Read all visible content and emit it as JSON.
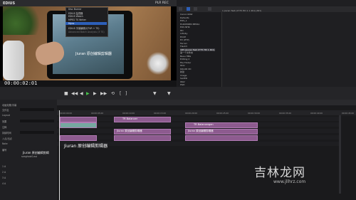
{
  "titlebar": {
    "app_name": "EDIUS",
    "plr_label": "PLR REC"
  },
  "preview": {
    "timecode": "00:00:02:01",
    "screen_caption": "Jiuran 原创编辑剪辑器",
    "menu": [
      {
        "label": "Disc Burner",
        "state": "normal"
      },
      {
        "label": "EDIUS 监视器",
        "state": "normal"
      },
      {
        "label": "EDIUS Watch",
        "state": "normal"
      },
      {
        "label": "MPEG TS Writer",
        "state": "normal"
      },
      {
        "label": "Mync",
        "state": "active"
      },
      {
        "label": "EDIUS 字幕编辑(QTVR + TS)",
        "state": "normal"
      },
      {
        "label": "Advanced Batch Analysis (3 TS)",
        "state": "dim"
      }
    ]
  },
  "bin": {
    "header": "Canon EOS 文件 | 8:0:07 | 时长 01:00:00",
    "clip_info": "1 Jiuran Test (2775 HD 1 1 4K1) (Brt)",
    "tree": [
      "Canon RAW",
      "Defaults",
      "EOS_1",
      "ELROMSEN MEDIA",
      "EOS NHK",
      "HD",
      "Infinity",
      "ECCE",
      "EV (PTP)",
      "Ferrari",
      "Flash3",
      "1D5 (Jiuran Test 2775 HD 1 4K1)",
      "第一个文件夹",
      "Beau HBG",
      "Editing 2",
      "File Folder",
      "HDV",
      "KOLOR XD",
      "新建",
      "Image",
      "SAVED",
      "WAV",
      "PGD",
      "视频素材"
    ],
    "selected_index": 11,
    "caption": "Jiuran 原创编辑剪辑"
  },
  "left_panel": {
    "rows": [
      "动画效果/字幕",
      "文件名",
      "Layout",
      "效果",
      "注释",
      "持续时间",
      "入点/出点",
      "Note",
      "编号"
    ],
    "mark": "Jiuran 原创编辑剪辑",
    "file": "seaghost0.avi",
    "rows2": [
      "1 A",
      "2 A",
      "3 A",
      "4 A"
    ]
  },
  "timeline": {
    "ticks": [
      "00:00:00:00",
      "00:00:05:00",
      "00:00:10:00",
      "00:00:15:00",
      "00:00:20:00",
      "00:00:25:00",
      "00:00:30:00",
      "00:00:35:00",
      "00:00:40:00",
      "00:00:45:00"
    ],
    "clips": [
      {
        "label": "Jiuran 原创编辑剪辑器",
        "kind": "title"
      },
      {
        "label": "TR Balancer",
        "kind": "video"
      },
      {
        "label": "TR Balance",
        "kind": "video"
      },
      {
        "label": "Jiuran 原创编辑剪辑器",
        "kind": "title"
      },
      {
        "label": "Jiuran 原创编辑剪辑器",
        "kind": "title"
      },
      {
        "label": "TR Balancergen",
        "kind": "video"
      }
    ]
  },
  "watermark": {
    "text": "吉林龙网",
    "url": "www.jllhrz.com"
  },
  "colors": {
    "accent": "#2d5fb8",
    "clip": "#8d5b8f",
    "title_clip": "#75a8a0",
    "play": "#45c24a"
  },
  "icons": {
    "play": "play-icon",
    "stop": "stop-icon",
    "rewind": "rewind-icon",
    "ffwd": "fast-forward-icon"
  }
}
